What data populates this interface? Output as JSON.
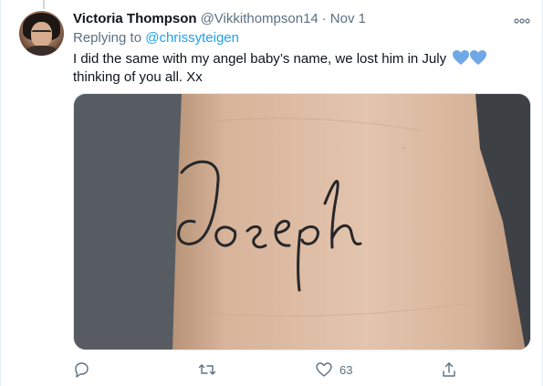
{
  "tweet": {
    "author_name": "Victoria Thompson",
    "author_handle": "@Vikkithompson14",
    "separator": "·",
    "date": "Nov 1",
    "replying_prefix": "Replying to",
    "replying_to": "@chrissyteigen",
    "text_line1": "I did the same with my angel baby’s name, we lost him in July",
    "text_line2": "thinking of you all. Xx",
    "emoji_icon": "blue-hearts-icon",
    "media_tattoo_text": "Joseph",
    "like_count": "63",
    "colors": {
      "link": "#1da1f2",
      "secondary_text": "#5b7083",
      "heart_emoji": "#6ea8e6"
    }
  },
  "actions": {
    "reply_icon": "reply-icon",
    "retweet_icon": "retweet-icon",
    "like_icon": "heart-icon",
    "share_icon": "share-icon",
    "more_icon": "more-options-icon"
  }
}
